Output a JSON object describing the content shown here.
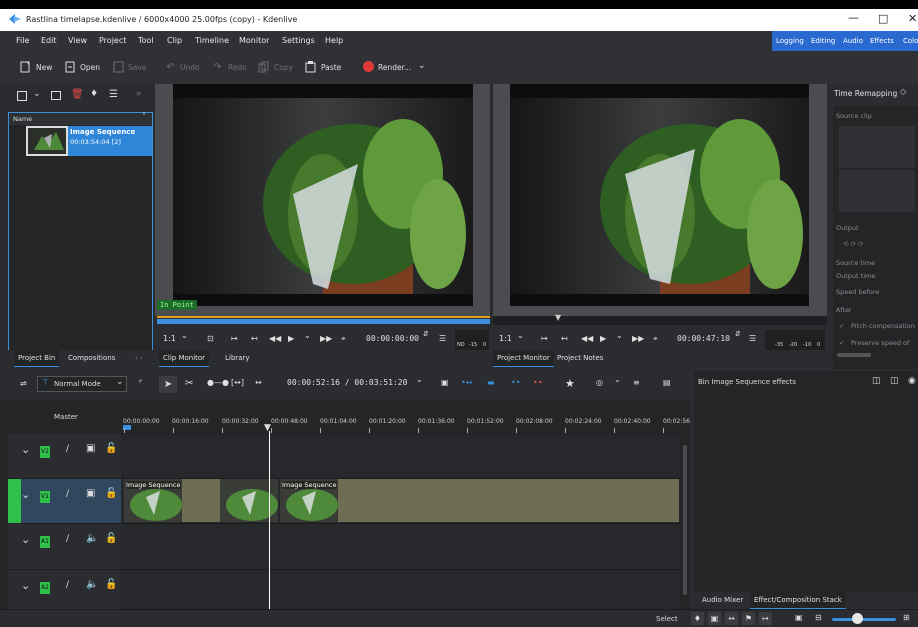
{
  "app": {
    "title": "Rastlina timelapse.kdenlive / 6000x4000 25.00fps (copy) - Kdenlive"
  },
  "colors": {
    "accent": "#3d8fe0",
    "workspace_bg": "#2a6ad0",
    "track_badge": "#2fbf4a",
    "clip_bg": "#6f6c54",
    "playhead": "#ffffff",
    "render_dot": "#e03a3a"
  },
  "menu": [
    "File",
    "Edit",
    "View",
    "Project",
    "Tool",
    "Clip",
    "Timeline",
    "Monitor",
    "Settings",
    "Help"
  ],
  "workspaces": [
    "Logging",
    "Editing",
    "Audio",
    "Effects",
    "Colo"
  ],
  "toolbar": {
    "new": "New",
    "open": "Open",
    "save": "Save",
    "undo": "Undo",
    "redo": "Redo",
    "copy": "Copy",
    "paste": "Paste",
    "render": "Render..."
  },
  "bin": {
    "column_name": "Name",
    "item_title": "Image Sequence",
    "item_duration": "00:03:54:04 [2]",
    "tabs": [
      "Project Bin",
      "Compositions"
    ]
  },
  "clip_monitor": {
    "in_point_label": "In Point",
    "zoom": "1:1",
    "timecode": "00:00:00:00",
    "tabs": [
      "Clip Monitor",
      "Library"
    ],
    "meter_labels": [
      "ND",
      "-15",
      "0"
    ]
  },
  "project_monitor": {
    "zoom": "1:1",
    "timecode": "00:00:47:10",
    "tabs": [
      "Project Monitor",
      "Project Notes"
    ],
    "meter_labels": [
      "-35",
      "-20",
      "-10",
      "0"
    ]
  },
  "time_remapping": {
    "title": "Time Remapping",
    "source_clip": "Source clip",
    "output": "Output",
    "source_time": "Source time",
    "output_time": "Output time",
    "speed_before": "Speed before",
    "after": "After",
    "pitch_compensation": "Pitch compensation",
    "preserve_speed": "Preserve speed of"
  },
  "timeline": {
    "mode": "Normal Mode",
    "timecode": "00:00:52:16 / 00:03:51:20",
    "master_label": "Master",
    "ruler": [
      "00:00:00:00",
      "00:00:16:00",
      "00:00:32:00",
      "00:00:48:00",
      "00:01:04:00",
      "00:01:20:00",
      "00:01:36:00",
      "00:01:52:00",
      "00:02:08:00",
      "00:02:24:00",
      "00:02:40:00",
      "00:02:56"
    ],
    "tracks": [
      {
        "name": "V2",
        "kind": "video"
      },
      {
        "name": "V1",
        "kind": "video"
      },
      {
        "name": "A1",
        "kind": "audio"
      },
      {
        "name": "A2",
        "kind": "audio"
      }
    ],
    "clips": [
      {
        "label": "Image Sequence"
      },
      {
        "label": ""
      },
      {
        "label": "Image Sequence"
      }
    ]
  },
  "effects": {
    "title": "Bin Image Sequence effects",
    "tabs": [
      "Audio Mixer",
      "Effect/Composition Stack"
    ]
  },
  "status": {
    "select": "Select"
  }
}
